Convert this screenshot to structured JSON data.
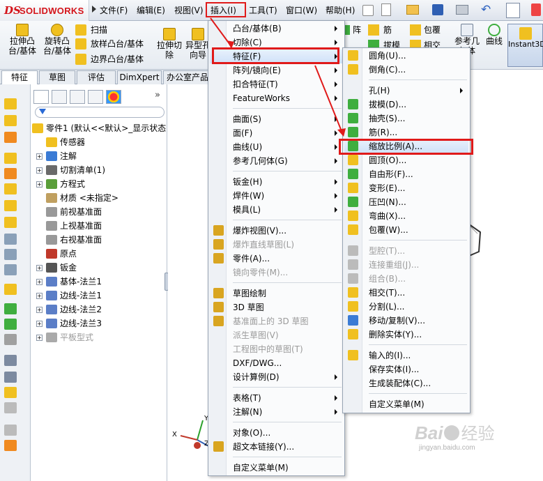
{
  "app": {
    "logo_ds": "DS",
    "logo_text": "SOLIDWORKS"
  },
  "menubar": {
    "items": [
      "文件(F)",
      "编辑(E)",
      "视图(V)",
      "插入(I)",
      "工具(T)",
      "窗口(W)",
      "帮助(H)"
    ]
  },
  "commands": [
    {
      "label1": "拉伸凸",
      "label2": "台/基体"
    },
    {
      "label1": "旋转凸",
      "label2": "台/基体"
    },
    {
      "label": "扫描"
    },
    {
      "label": "放样凸台/基体"
    },
    {
      "label": "边界凸台/基体"
    },
    {
      "label1": "拉伸切",
      "label2": "除"
    },
    {
      "label1": "异型孔",
      "label2": "向导"
    },
    {
      "label": "阵列"
    },
    {
      "label": "筋"
    },
    {
      "label": "包覆"
    },
    {
      "label": "拔模"
    },
    {
      "label": "相交"
    },
    {
      "label1": "参考几",
      "label2": "何体"
    },
    {
      "label": "曲线"
    },
    {
      "label": "Instant3D"
    }
  ],
  "tabs": [
    "特征",
    "草图",
    "评估",
    "DimXpert",
    "办公室产品"
  ],
  "tree": [
    {
      "label": "零件1  (默认<<默认>_显示状态",
      "expand": "",
      "indent": 0
    },
    {
      "label": "传感器",
      "expand": "",
      "indent": 1
    },
    {
      "label": "注解",
      "expand": "+",
      "indent": 1
    },
    {
      "label": "切割清单(1)",
      "expand": "+",
      "indent": 1
    },
    {
      "label": "方程式",
      "expand": "+",
      "indent": 1
    },
    {
      "label": "材质 <未指定>",
      "expand": "",
      "indent": 1
    },
    {
      "label": "前视基准面",
      "expand": "",
      "indent": 1
    },
    {
      "label": "上视基准面",
      "expand": "",
      "indent": 1
    },
    {
      "label": "右视基准面",
      "expand": "",
      "indent": 1
    },
    {
      "label": "原点",
      "expand": "",
      "indent": 1
    },
    {
      "label": "钣金",
      "expand": "+",
      "indent": 1
    },
    {
      "label": "基体-法兰1",
      "expand": "+",
      "indent": 1
    },
    {
      "label": "边线-法兰1",
      "expand": "+",
      "indent": 1
    },
    {
      "label": "边线-法兰2",
      "expand": "+",
      "indent": 1
    },
    {
      "label": "边线-法兰3",
      "expand": "+",
      "indent": 1
    },
    {
      "label": "平板型式",
      "expand": "+",
      "indent": 1,
      "disabled": true
    }
  ],
  "insert_menu": [
    {
      "label": "凸台/基体(B)",
      "sub": true
    },
    {
      "label": "切除(C)",
      "sub": true
    },
    {
      "label": "特征(F)",
      "sub": true,
      "highlight": true
    },
    {
      "label": "阵列/镜向(E)",
      "sub": true
    },
    {
      "label": "扣合特征(T)",
      "sub": true
    },
    {
      "label": "FeatureWorks",
      "sub": true
    },
    {
      "sep": true
    },
    {
      "label": "曲面(S)",
      "sub": true
    },
    {
      "label": "面(F)",
      "sub": true
    },
    {
      "label": "曲线(U)",
      "sub": true
    },
    {
      "label": "参考几何体(G)",
      "sub": true
    },
    {
      "sep": true
    },
    {
      "label": "钣金(H)",
      "sub": true
    },
    {
      "label": "焊件(W)",
      "sub": true
    },
    {
      "label": "模具(L)",
      "sub": true
    },
    {
      "sep": true
    },
    {
      "label": "爆炸视图(V)...",
      "icon": true
    },
    {
      "label": "爆炸直线草图(L)",
      "disabled": true,
      "icon": true
    },
    {
      "label": "零件(A)...",
      "icon": true
    },
    {
      "label": "镜向零件(M)...",
      "disabled": true
    },
    {
      "sep": true
    },
    {
      "label": "草图绘制",
      "icon": true
    },
    {
      "label": "3D 草图",
      "icon": true
    },
    {
      "label": "基准面上的 3D 草图",
      "disabled": true,
      "icon": true
    },
    {
      "label": "派生草图(V)",
      "disabled": true
    },
    {
      "label": "工程图中的草图(T)",
      "disabled": true
    },
    {
      "label": "DXF/DWG..."
    },
    {
      "label": "设计算例(D)",
      "sub": true
    },
    {
      "sep": true
    },
    {
      "label": "表格(T)",
      "sub": true
    },
    {
      "label": "注解(N)",
      "sub": true
    },
    {
      "sep": true
    },
    {
      "label": "对象(O)..."
    },
    {
      "label": "超文本链接(Y)...",
      "icon": true
    },
    {
      "sep": true
    },
    {
      "label": "自定义菜单(M)"
    }
  ],
  "feature_menu": [
    {
      "label": "圆角(U)...",
      "icon": "#f0c020"
    },
    {
      "label": "倒角(C)...",
      "icon": "#f0c020"
    },
    {
      "sep": true
    },
    {
      "label": "孔(H)",
      "sub": true
    },
    {
      "label": "拔模(D)...",
      "icon": "#3fae3f"
    },
    {
      "label": "抽壳(S)...",
      "icon": "#3fae3f"
    },
    {
      "label": "筋(R)...",
      "icon": "#3fae3f"
    },
    {
      "label": "缩放比例(A)...",
      "icon": "#3fae3f",
      "highlight": true
    },
    {
      "label": "圆顶(O)...",
      "icon": "#f0c020"
    },
    {
      "label": "自由形(F)...",
      "icon": "#3fae3f"
    },
    {
      "label": "变形(E)...",
      "icon": "#f0c020"
    },
    {
      "label": "压凹(N)...",
      "icon": "#3fae3f"
    },
    {
      "label": "弯曲(X)...",
      "icon": "#f0c020"
    },
    {
      "label": "包覆(W)...",
      "icon": "#f0c020"
    },
    {
      "sep": true
    },
    {
      "label": "型腔(T)...",
      "disabled": true,
      "icon": "#bbbbbb"
    },
    {
      "label": "连接重组(J)...",
      "disabled": true,
      "icon": "#bbbbbb"
    },
    {
      "label": "组合(B)...",
      "disabled": true,
      "icon": "#bbbbbb"
    },
    {
      "label": "相交(T)...",
      "icon": "#f0c020"
    },
    {
      "label": "分割(L)...",
      "icon": "#f0c020"
    },
    {
      "label": "移动/复制(V)...",
      "icon": "#3a7bd5"
    },
    {
      "label": "删除实体(Y)...",
      "icon": "#f0c020"
    },
    {
      "sep": true
    },
    {
      "label": "输入的(I)...",
      "icon": "#f0c020"
    },
    {
      "label": "保存实体(I)..."
    },
    {
      "label": "生成装配体(C)..."
    },
    {
      "sep": true
    },
    {
      "label": "自定义菜单(M)"
    }
  ],
  "watermark": {
    "brand": "Bai",
    "brand2": "经验",
    "site": "jingyan.baidu.com"
  },
  "axes": {
    "x": "X",
    "y": "Y",
    "z": "Z"
  }
}
